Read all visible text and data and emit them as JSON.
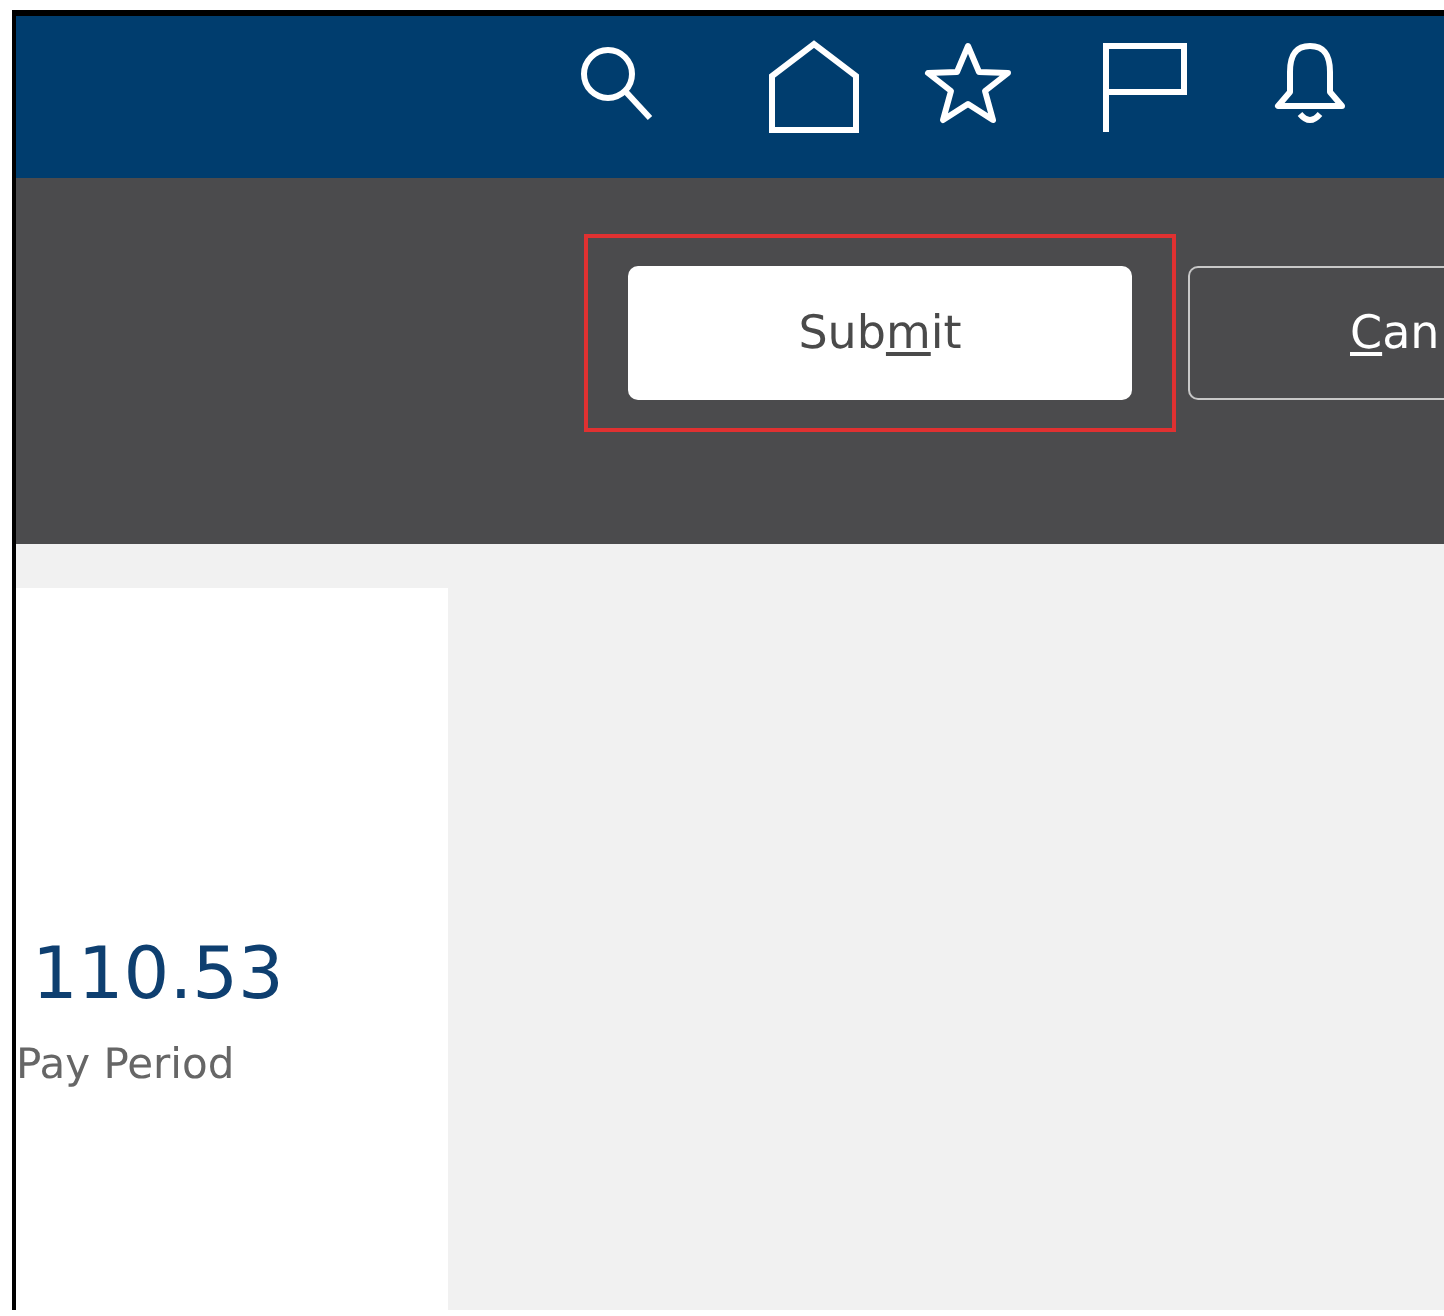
{
  "top_bar": {
    "icons": [
      {
        "kind": "search"
      },
      {
        "kind": "home"
      },
      {
        "kind": "star"
      },
      {
        "kind": "flag"
      },
      {
        "kind": "bell"
      }
    ]
  },
  "action_bar": {
    "buttons": [
      {
        "kind": "primary",
        "highlighted": true,
        "before_key": "Sub",
        "access_key": "m",
        "after_key": "it"
      },
      {
        "kind": "secondary",
        "highlighted": false,
        "access_key": "C",
        "after_key": "an"
      }
    ]
  },
  "card": {
    "amount": "110.53",
    "caption": "Pay Period"
  }
}
